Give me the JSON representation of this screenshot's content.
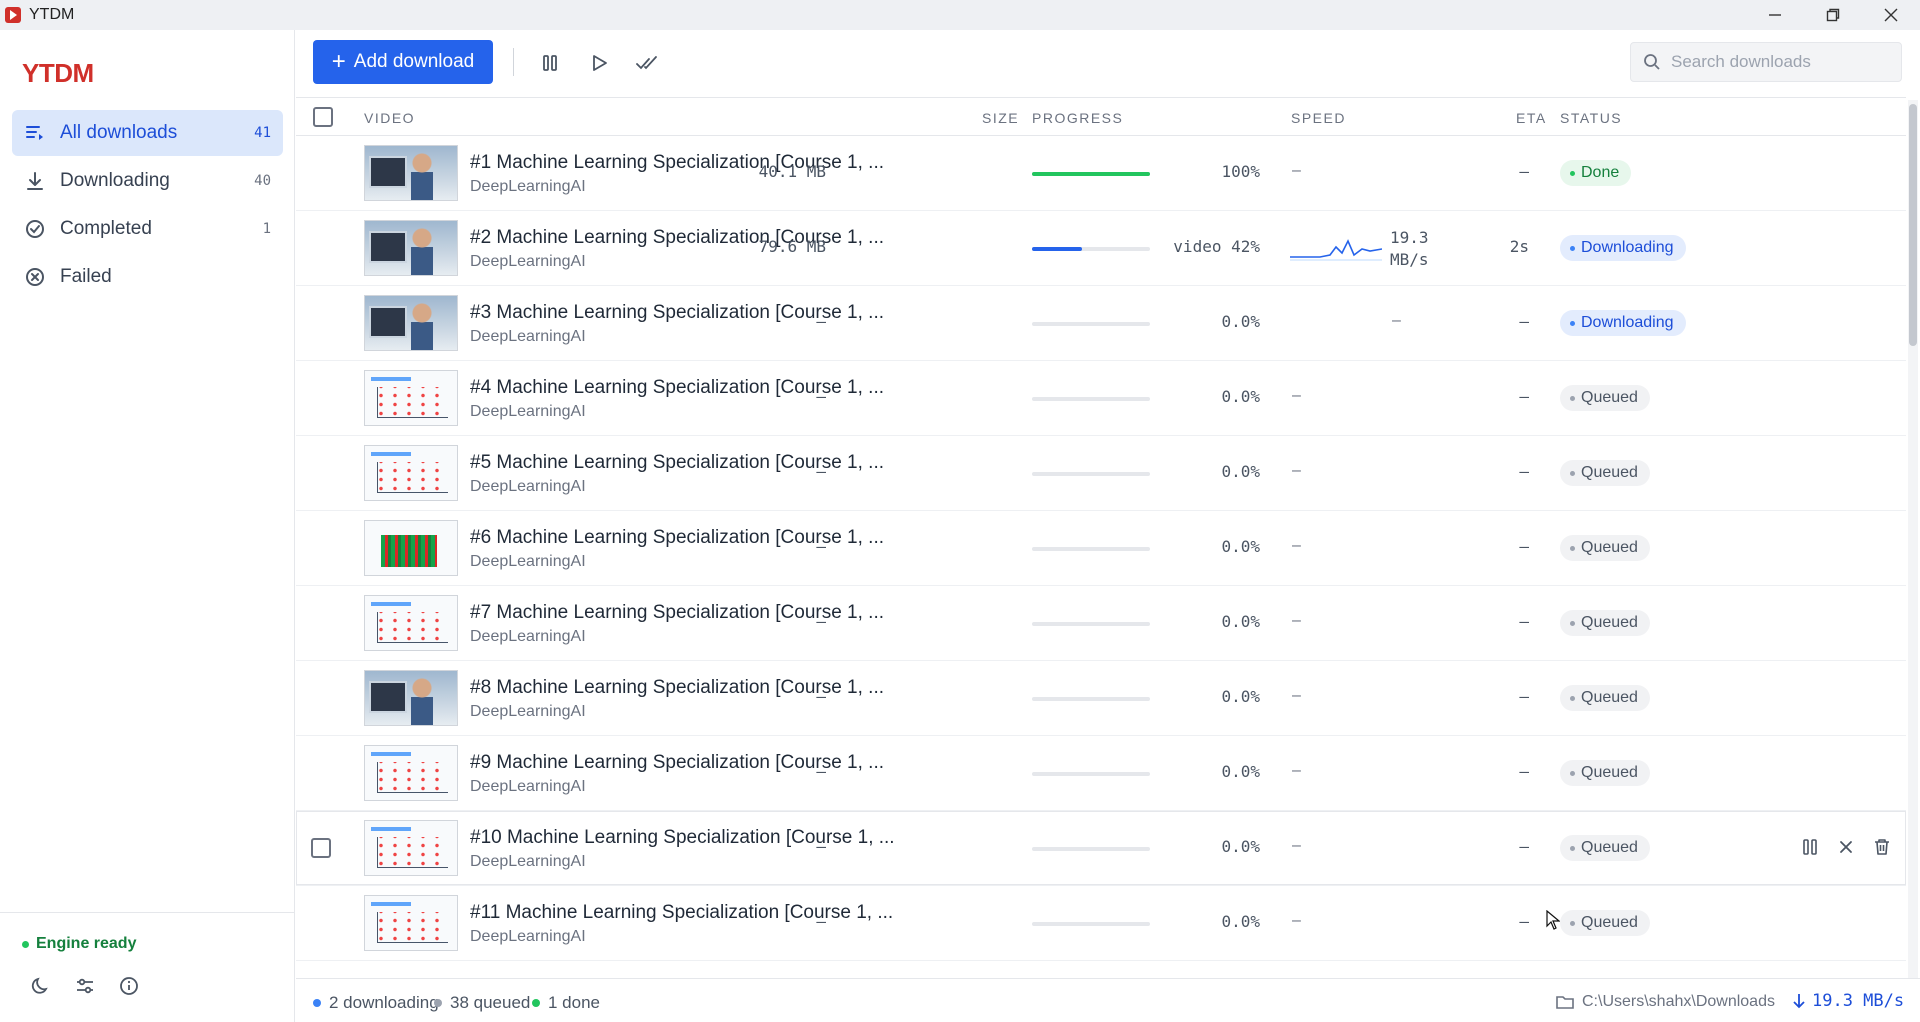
{
  "window": {
    "title": "YTDM"
  },
  "sidebar": {
    "logo": "YTDM",
    "items": [
      {
        "label": "All downloads",
        "count": "41"
      },
      {
        "label": "Downloading",
        "count": "40"
      },
      {
        "label": "Completed",
        "count": "1"
      },
      {
        "label": "Failed",
        "count": ""
      }
    ],
    "engine_status": "Engine ready"
  },
  "toolbar": {
    "add_label": "Add download",
    "search_placeholder": "Search downloads"
  },
  "table": {
    "headers": {
      "video": "VIDEO",
      "size": "SIZE",
      "progress": "PROGRESS",
      "speed": "SPEED",
      "eta": "ETA",
      "status": "STATUS"
    },
    "rows": [
      {
        "title": "#1 Machine Learning Specialization [Course 1, ...",
        "channel": "DeepLearningAI",
        "size": "40.1 MB",
        "progress": 1.0,
        "pct": "100%",
        "speed": "–",
        "speed_val": "",
        "eta": "–",
        "status": "Done"
      },
      {
        "title": "#2 Machine Learning Specialization [Course 1, ...",
        "channel": "DeepLearningAI",
        "size": "79.6 MB",
        "progress": 0.42,
        "pct": "video 42%",
        "speed": "",
        "speed_val": "19.3",
        "speed_unit": "MB/s",
        "eta": "2s",
        "status": "Downloading"
      },
      {
        "title": "#3 Machine Learning Specialization [Course 1, ...",
        "channel": "DeepLearningAI",
        "size": "–",
        "progress": 0,
        "pct": "0.0%",
        "speed": "–",
        "speed_val": "",
        "eta": "–",
        "status": "Downloading"
      },
      {
        "title": "#4 Machine Learning Specialization [Course 1, ...",
        "channel": "DeepLearningAI",
        "size": "–",
        "progress": 0,
        "pct": "0.0%",
        "speed": "–",
        "speed_val": "",
        "eta": "–",
        "status": "Queued"
      },
      {
        "title": "#5 Machine Learning Specialization [Course 1, ...",
        "channel": "DeepLearningAI",
        "size": "–",
        "progress": 0,
        "pct": "0.0%",
        "speed": "–",
        "speed_val": "",
        "eta": "–",
        "status": "Queued"
      },
      {
        "title": "#6 Machine Learning Specialization [Course 1, ...",
        "channel": "DeepLearningAI",
        "size": "–",
        "progress": 0,
        "pct": "0.0%",
        "speed": "–",
        "speed_val": "",
        "eta": "–",
        "status": "Queued"
      },
      {
        "title": "#7 Machine Learning Specialization [Course 1, ...",
        "channel": "DeepLearningAI",
        "size": "–",
        "progress": 0,
        "pct": "0.0%",
        "speed": "–",
        "speed_val": "",
        "eta": "–",
        "status": "Queued"
      },
      {
        "title": "#8 Machine Learning Specialization [Course 1, ...",
        "channel": "DeepLearningAI",
        "size": "–",
        "progress": 0,
        "pct": "0.0%",
        "speed": "–",
        "speed_val": "",
        "eta": "–",
        "status": "Queued"
      },
      {
        "title": "#9 Machine Learning Specialization [Course 1, ...",
        "channel": "DeepLearningAI",
        "size": "–",
        "progress": 0,
        "pct": "0.0%",
        "speed": "–",
        "speed_val": "",
        "eta": "–",
        "status": "Queued"
      },
      {
        "title": "#10 Machine Learning Specialization [Course 1, ...",
        "channel": "DeepLearningAI",
        "size": "–",
        "progress": 0,
        "pct": "0.0%",
        "speed": "–",
        "speed_val": "",
        "eta": "–",
        "status": "Queued"
      },
      {
        "title": "#11 Machine Learning Specialization [Course 1, ...",
        "channel": "DeepLearningAI",
        "size": "–",
        "progress": 0,
        "pct": "0.0%",
        "speed": "–",
        "speed_val": "",
        "eta": "–",
        "status": "Queued"
      }
    ]
  },
  "statusbar": {
    "downloading": "2 downloading",
    "queued": "38 queued",
    "done": "1 done",
    "path": "C:\\Users\\shahx\\Downloads",
    "total_speed": "19.3 MB/s"
  },
  "colors": {
    "accent": "#2563eb",
    "done": "#22c55e",
    "queued": "#9ca3af",
    "brand": "#d0302a"
  },
  "icons": {
    "pause_all": "pause-icon",
    "resume_all": "play-icon",
    "clear_done": "double-check-icon",
    "theme": "moon-icon",
    "settings": "sliders-icon",
    "about": "info-icon"
  }
}
